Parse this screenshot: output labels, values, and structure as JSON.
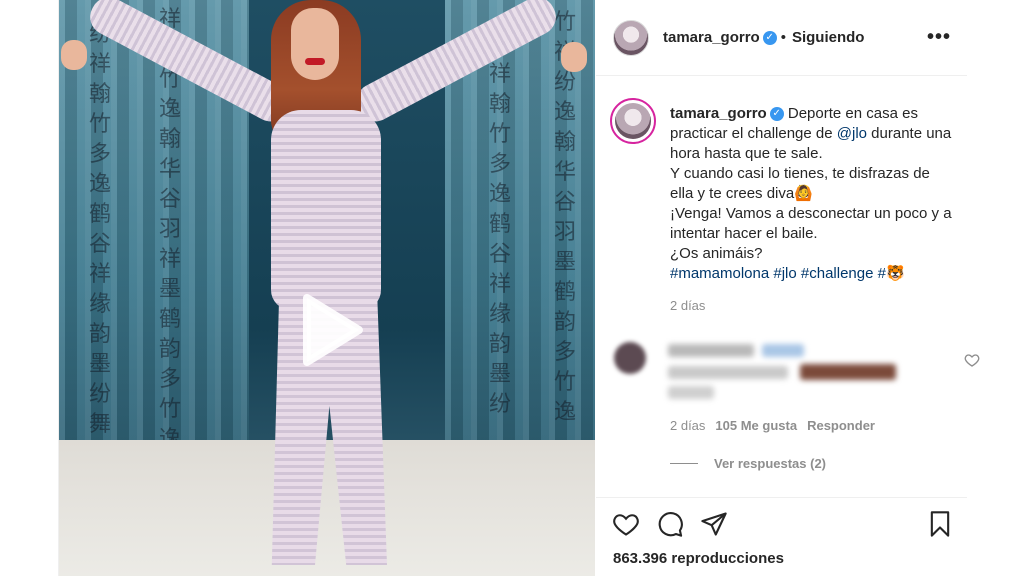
{
  "post": {
    "username": "tamara_gorro",
    "follow_status": "Siguiendo",
    "separator": "•",
    "more_label": "•••",
    "verified_glyph": "✓"
  },
  "caption": {
    "username": "tamara_gorro",
    "line1_pre": "Deporte en casa es practicar el challenge de ",
    "mention": "@jlo",
    "line1_post": " durante una hora hasta que te sale.",
    "line2": "Y cuando casi lo tienes, te disfrazas de ella y te crees diva",
    "emoji_diva": "🙆",
    "line3": "¡Venga! Vamos a desconectar un poco y a intentar hacer el baile.",
    "line4": "¿Os animáis?",
    "hashtags": "#mamamolona #jlo #challenge #",
    "emoji_end": "🐯",
    "time": "2 días"
  },
  "comment": {
    "time": "2 días",
    "likes": "105 Me gusta",
    "reply": "Responder",
    "view_replies": "Ver respuestas (2)"
  },
  "footer": {
    "views": "863.396 reproducciones"
  },
  "icons": {
    "like": "heart-icon",
    "comment": "comment-icon",
    "share": "share-icon",
    "save": "bookmark-icon",
    "play": "play-icon"
  },
  "colors": {
    "text": "#262626",
    "muted": "#8e8e8e",
    "link": "#00376b",
    "verified": "#3897f0",
    "border": "#efefef"
  }
}
